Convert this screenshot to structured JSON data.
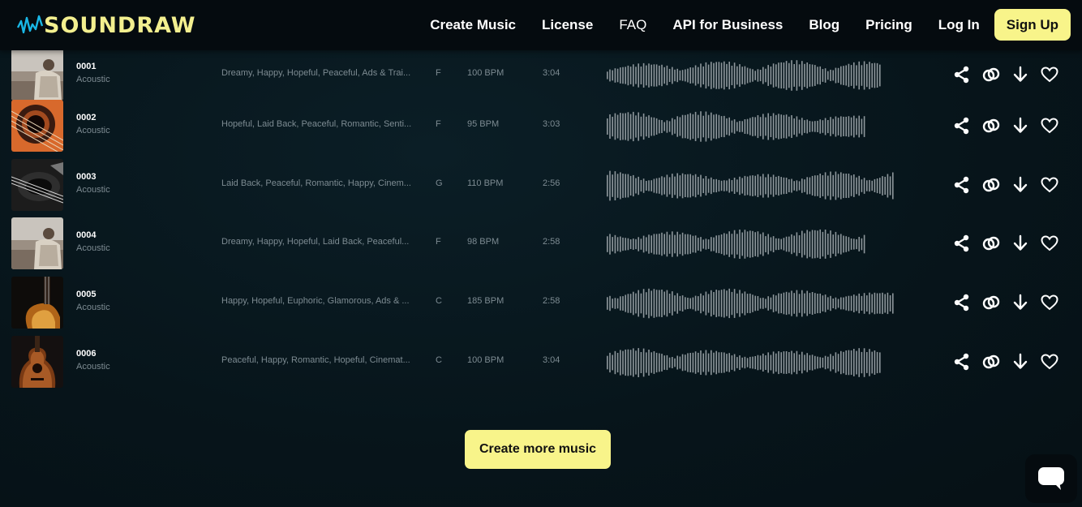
{
  "brand": {
    "name": "SOUNDRAW",
    "accent": "#f8f48a",
    "wave_accent": "#19b7e6"
  },
  "nav": {
    "items": [
      "Create Music",
      "License",
      "FAQ",
      "API for Business",
      "Blog",
      "Pricing",
      "Log In"
    ],
    "signup_label": "Sign Up"
  },
  "tracks": [
    {
      "title": "0001",
      "genre": "Acoustic",
      "tags": "Dreamy, Happy, Hopeful, Peaceful, Ads & Trai...",
      "key": "F",
      "bpm": "100 BPM",
      "duration": "3:04",
      "thumb": "beach"
    },
    {
      "title": "0002",
      "genre": "Acoustic",
      "tags": "Hopeful, Laid Back, Peaceful, Romantic, Senti...",
      "key": "F",
      "bpm": "95 BPM",
      "duration": "3:03",
      "thumb": "guitar-orange"
    },
    {
      "title": "0003",
      "genre": "Acoustic",
      "tags": "Laid Back, Peaceful, Romantic, Happy, Cinem...",
      "key": "G",
      "bpm": "110 BPM",
      "duration": "2:56",
      "thumb": "guitar-bw"
    },
    {
      "title": "0004",
      "genre": "Acoustic",
      "tags": "Dreamy, Happy, Hopeful, Laid Back, Peaceful...",
      "key": "F",
      "bpm": "98 BPM",
      "duration": "2:58",
      "thumb": "beach"
    },
    {
      "title": "0005",
      "genre": "Acoustic",
      "tags": "Happy, Hopeful, Euphoric, Glamorous, Ads & ...",
      "key": "C",
      "bpm": "185 BPM",
      "duration": "2:58",
      "thumb": "guitar-dark"
    },
    {
      "title": "0006",
      "genre": "Acoustic",
      "tags": "Peaceful, Happy, Romantic, Hopeful, Cinemat...",
      "key": "C",
      "bpm": "100 BPM",
      "duration": "3:04",
      "thumb": "guitar-wood"
    }
  ],
  "row_icons": [
    "share-icon",
    "link-icon",
    "download-icon",
    "heart-icon"
  ],
  "cta_label": "Create more music",
  "chat_icon": "chat-icon"
}
